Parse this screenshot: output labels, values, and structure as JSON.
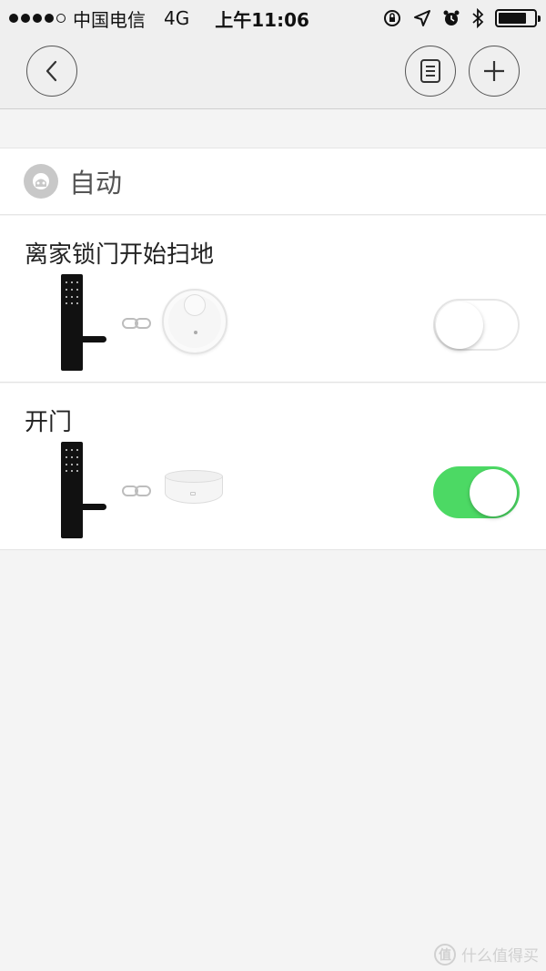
{
  "status_bar": {
    "carrier": "中国电信",
    "network": "4G",
    "time": "上午11:06",
    "signal_bars": 4,
    "signal_total": 5,
    "battery_level_percent": 80
  },
  "nav": {
    "icons": [
      "back-chevron-icon",
      "list-document-icon",
      "plus-icon"
    ]
  },
  "section": {
    "title": "自动",
    "icon": "auto-scene-icon"
  },
  "scenes": [
    {
      "title": "离家锁门开始扫地",
      "trigger_device": "smart-lock",
      "action_device": "robot-vacuum",
      "enabled": false
    },
    {
      "title": "开门",
      "trigger_device": "smart-lock",
      "action_device": "gateway",
      "enabled": true
    }
  ],
  "watermark": {
    "badge": "值",
    "text": "什么值得买"
  },
  "colors": {
    "toggle_on": "#4cd964",
    "background": "#f4f4f4",
    "card": "#ffffff"
  }
}
